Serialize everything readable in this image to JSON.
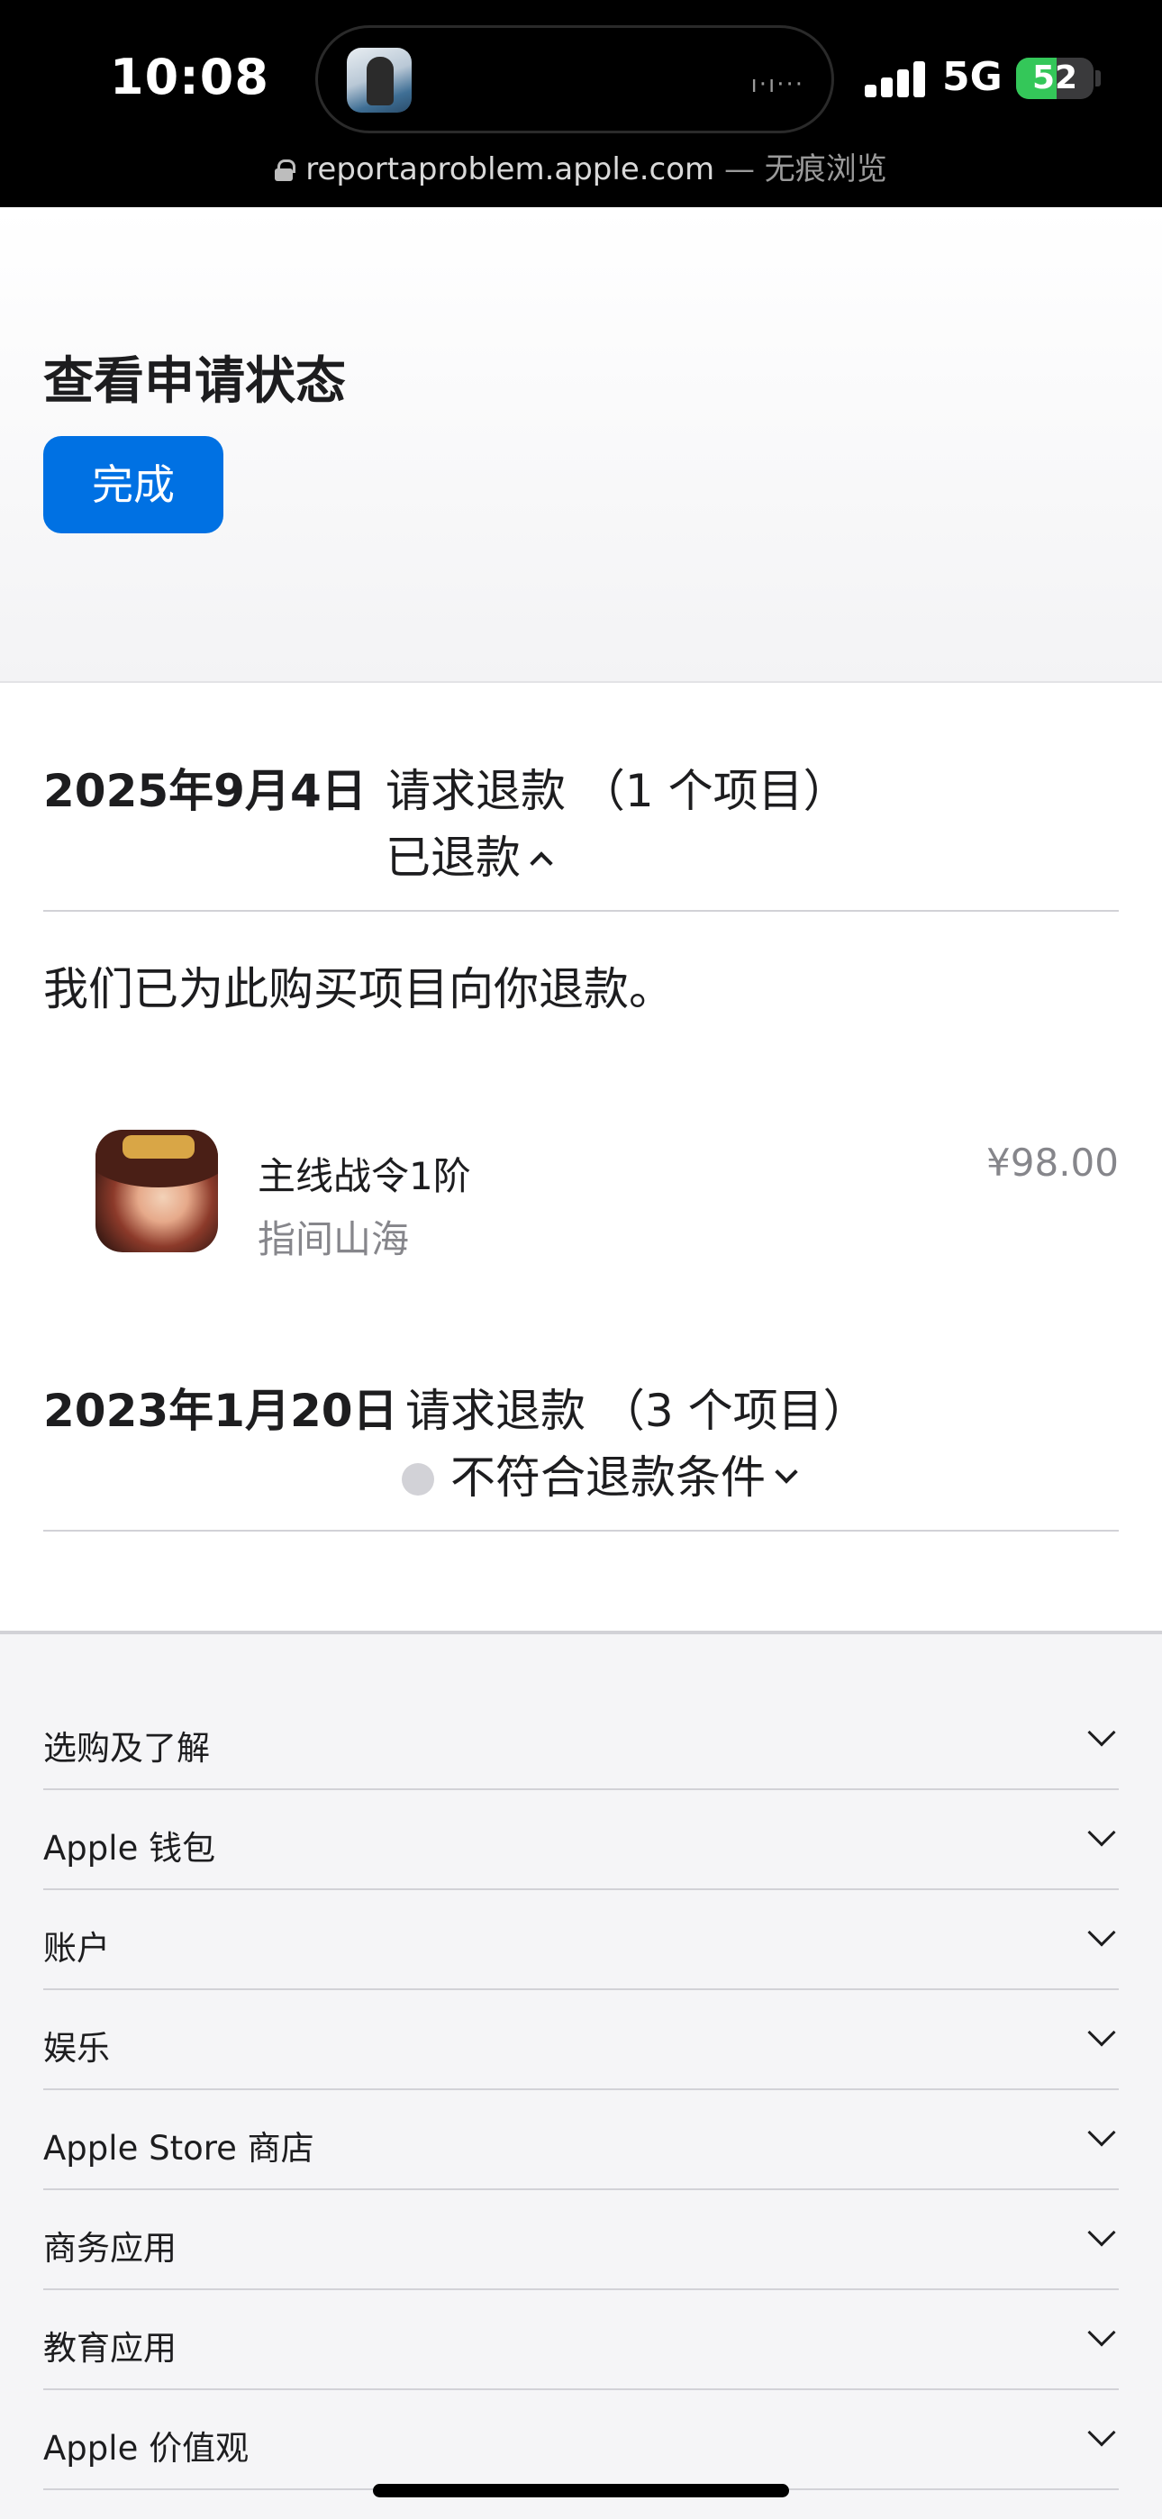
{
  "status_bar": {
    "time": "10:08",
    "network": "5G",
    "battery": "52",
    "battery_level": 0.52,
    "island_dots": "ı·ı···"
  },
  "url_bar": {
    "domain": "reportaproblem.apple.com",
    "suffix": " — 无痕浏览"
  },
  "header": {
    "title": "查看申请状态",
    "done_label": "完成"
  },
  "requests": [
    {
      "date": "2025年9月4日",
      "title": "请求退款 （1 个项目）",
      "status": "已退款",
      "message": "我们已为此购买项目向你退款。",
      "item": {
        "name": "主线战令1阶",
        "app": "指间山海",
        "price": "¥98.00"
      }
    },
    {
      "date": "2023年1月20日",
      "title": "请求退款 （3 个项目）",
      "status": "不符合退款条件"
    }
  ],
  "footer": {
    "items": [
      "选购及了解",
      "Apple 钱包",
      "账户",
      "娱乐",
      "Apple Store 商店",
      "商务应用",
      "教育应用",
      "Apple 价值观"
    ]
  },
  "colors": {
    "accent": "#0071e3",
    "battery_green": "#34c759",
    "secondary_text": "#86868b"
  }
}
